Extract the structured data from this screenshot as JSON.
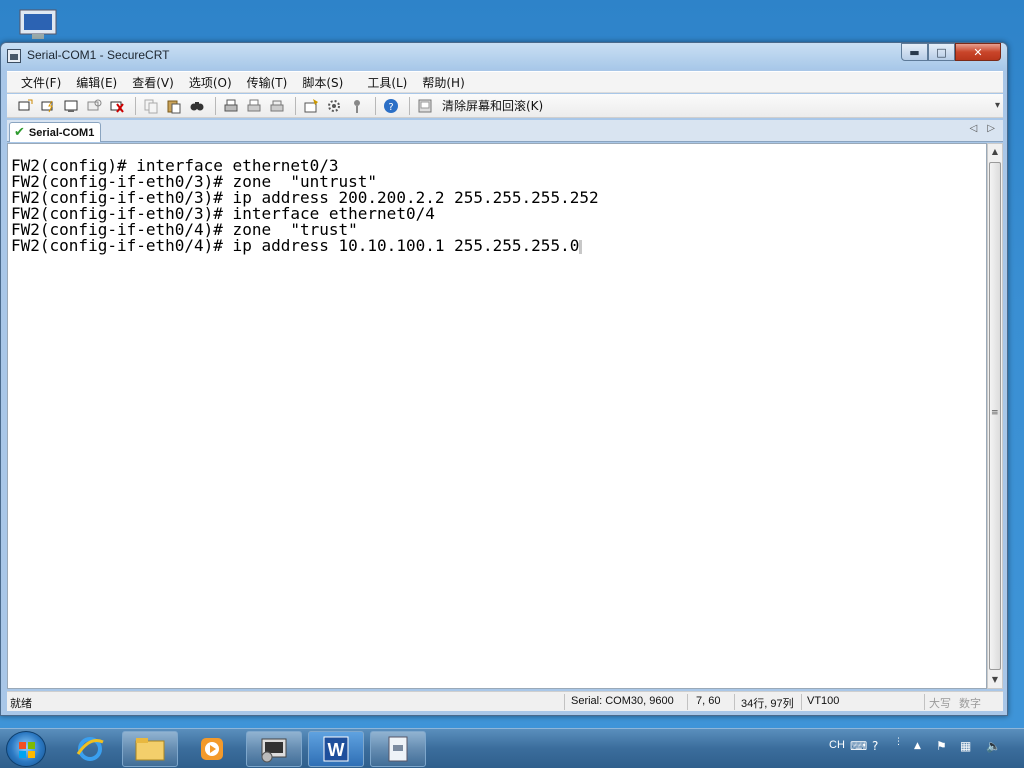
{
  "window": {
    "title": "Serial-COM1 - SecureCRT",
    "buttons": {
      "minimize": "▬",
      "maximize": "□",
      "close": "✕"
    }
  },
  "menu": {
    "items": [
      "文件(F)",
      "编辑(E)",
      "查看(V)",
      "选项(O)",
      "传输(T)",
      "脚本(S)",
      "工具(L)",
      "帮助(H)"
    ]
  },
  "toolbar": {
    "icons": [
      "connect-icon",
      "quick-connect-icon",
      "connect-tab-icon",
      "reconnect-icon",
      "disconnect-icon",
      "copy-icon",
      "paste-icon",
      "find-icon",
      "print-icon",
      "print-selection-icon",
      "print-setup-icon",
      "session-options-icon",
      "global-options-icon",
      "keymap-icon",
      "help-icon",
      "clear-screen-icon"
    ],
    "clear_label": "清除屏幕和回滚(K)"
  },
  "tabs": {
    "active": {
      "label": "Serial-COM1",
      "status_icon": "connected-check-icon"
    }
  },
  "terminal": {
    "lines": [
      "FW2(config)# interface ethernet0/3",
      "FW2(config-if-eth0/3)# zone  \"untrust\"",
      "FW2(config-if-eth0/3)# ip address 200.200.2.2 255.255.255.252",
      "FW2(config-if-eth0/3)# interface ethernet0/4",
      "FW2(config-if-eth0/4)# zone  \"trust\"",
      "FW2(config-if-eth0/4)# ip address 10.10.100.1 255.255.255.0"
    ]
  },
  "status": {
    "ready": "就绪",
    "connection": "Serial: COM30, 9600",
    "cursor_pos": "7, 60",
    "dimensions": "34行, 97列",
    "emulation": "VT100",
    "caps": "大写",
    "num": "数字"
  },
  "taskbar": {
    "items": [
      "start-button",
      "ie-icon",
      "explorer-icon",
      "media-player-icon",
      "securecrt-icon",
      "word-icon",
      "notepad-icon"
    ],
    "tray": {
      "ime": "CH"
    }
  },
  "colors": {
    "desktop": "#3a8fd3",
    "window_frame": "#a9c7e8",
    "terminal_bg": "#ffffff",
    "terminal_fg": "#000000"
  }
}
